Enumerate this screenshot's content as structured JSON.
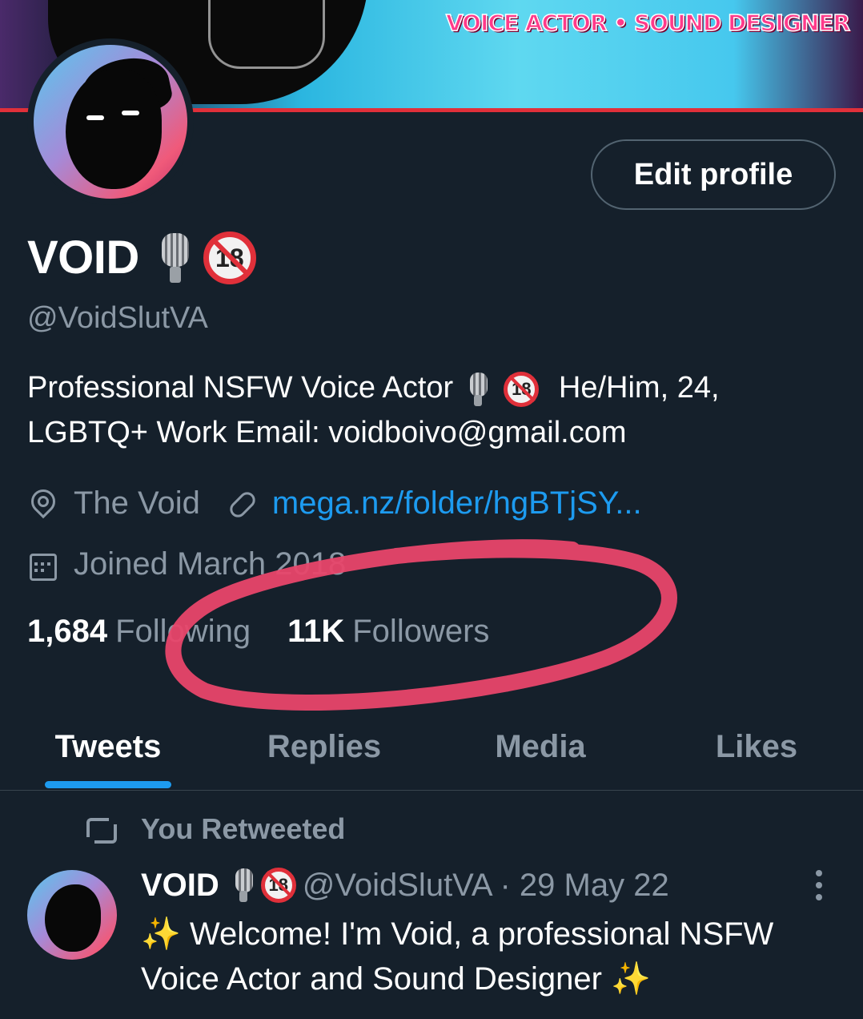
{
  "banner": {
    "tagline": "VOICE ACTOR • SOUND DESIGNER"
  },
  "profile": {
    "edit_button": "Edit profile",
    "name": "VOID",
    "badge_18": "18",
    "handle": "@VoidSlutVA",
    "bio_line1_a": "Professional NSFW Voice Actor",
    "bio_line1_b": "He/Him, 24,",
    "bio_line2": "LGBTQ+  Work Email: voidboivo@gmail.com",
    "location": "The Void",
    "website": "mega.nz/folder/hgBTjSY...",
    "joined": "Joined March 2018"
  },
  "stats": {
    "following_count": "1,684",
    "following_label": "Following",
    "followers_count": "11K",
    "followers_label": "Followers"
  },
  "tabs": [
    "Tweets",
    "Replies",
    "Media",
    "Likes"
  ],
  "active_tab": "Tweets",
  "feed": {
    "retweet_label": "You Retweeted",
    "tweet": {
      "name": "VOID",
      "badge_18": "18",
      "handle_date": "@VoidSlutVA · 29 May 22",
      "sparkle": "✨",
      "text": "Welcome! I'm Void, a professional NSFW Voice Actor and Sound Designer"
    }
  },
  "colors": {
    "background": "#15202b",
    "accent": "#1d9bf0",
    "muted_text": "#8b98a5",
    "annotation": "#e8466a"
  }
}
